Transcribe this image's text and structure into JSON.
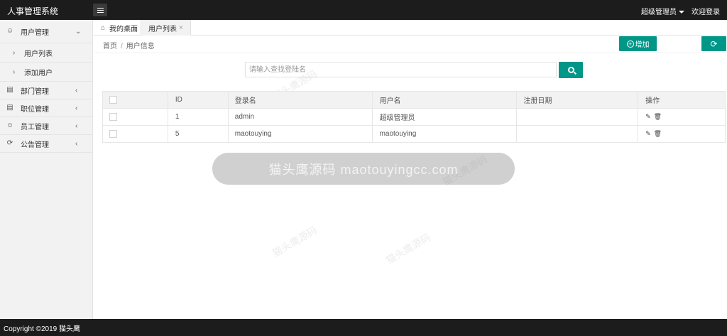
{
  "header": {
    "app_title": "人事管理系统",
    "user_menu_label": "超级管理员",
    "login_link": "欢迎登录"
  },
  "sidebar": {
    "items": [
      {
        "label": "用户管理",
        "icon": "user-icon",
        "expanded": true
      },
      {
        "label": "部门管理",
        "icon": "building-icon"
      },
      {
        "label": "职位管理",
        "icon": "briefcase-icon"
      },
      {
        "label": "员工管理",
        "icon": "users-icon"
      },
      {
        "label": "公告管理",
        "icon": "megaphone-icon"
      }
    ],
    "subitems": [
      {
        "label": "用户列表"
      },
      {
        "label": "添加用户"
      }
    ]
  },
  "tabs": {
    "home_label": "我的桌面",
    "active_label": "用户列表"
  },
  "breadcrumb": {
    "home": "首页",
    "separator": "/",
    "current": "用户信息"
  },
  "toolbar": {
    "add_label": "增加"
  },
  "search": {
    "placeholder": "请输入查找登陆名"
  },
  "table": {
    "columns": [
      "ID",
      "登录名",
      "用户名",
      "注册日期",
      "操作"
    ],
    "rows": [
      {
        "id": "1",
        "login": "admin",
        "username": "超级管理员",
        "date": ""
      },
      {
        "id": "5",
        "login": "maotouying",
        "username": "maotouying",
        "date": ""
      }
    ]
  },
  "watermark": {
    "band_text": "猫头鹰源码 maotouyingcc.com",
    "small_text": "猫头鹰源码"
  },
  "footer": {
    "copyright": "Copyright ©2019 猫头鹰"
  },
  "colors": {
    "accent": "#009688",
    "topbar": "#1c1c1c",
    "sidebar": "#f2f2f2"
  }
}
